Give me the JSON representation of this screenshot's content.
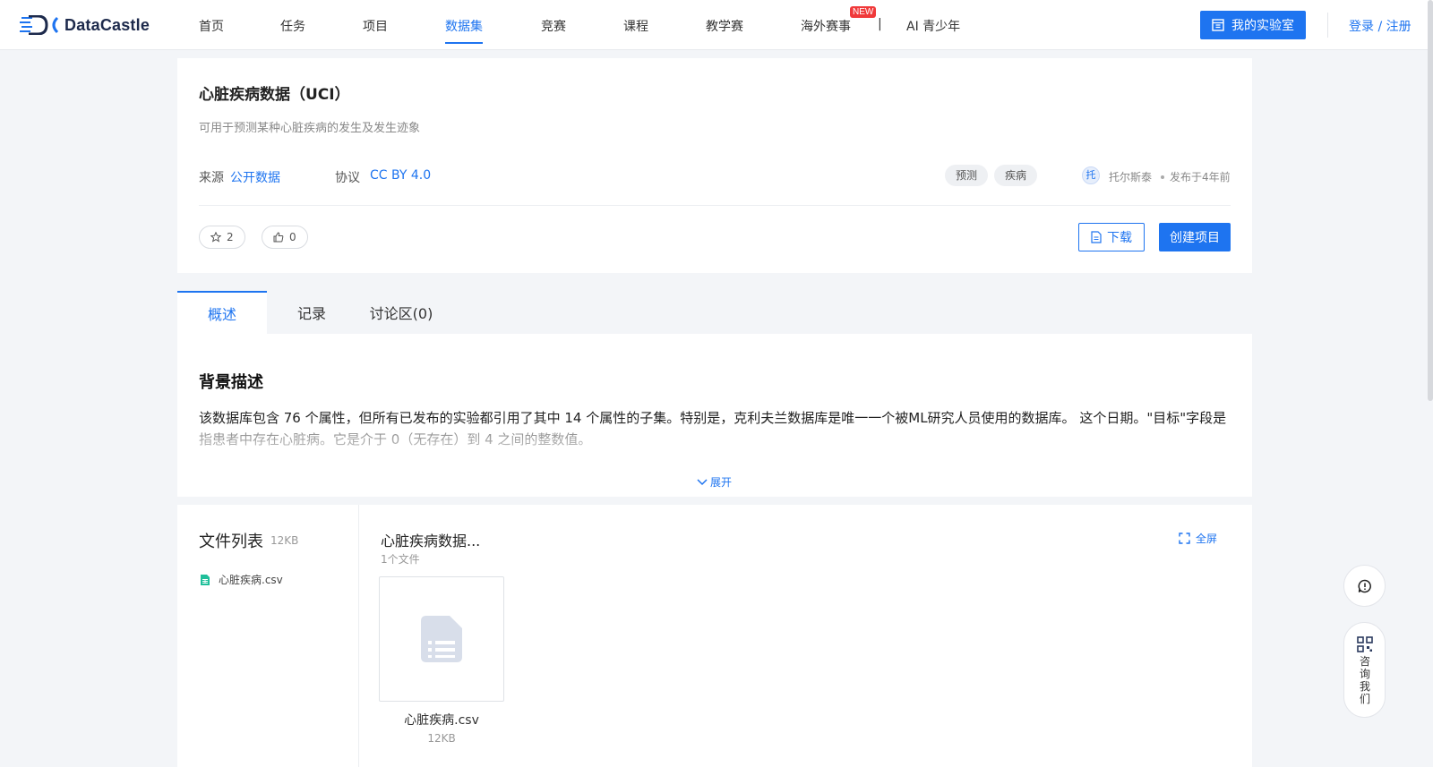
{
  "brand": {
    "name": "DataCastle",
    "accent": "#1e74f0"
  },
  "nav": {
    "items": [
      {
        "label": "首页"
      },
      {
        "label": "任务"
      },
      {
        "label": "项目"
      },
      {
        "label": "数据集"
      },
      {
        "label": "竞赛"
      },
      {
        "label": "课程"
      },
      {
        "label": "教学赛"
      },
      {
        "label": "海外赛事"
      },
      {
        "label": "AI 青少年"
      }
    ],
    "active_label": "数据集",
    "badge": "NEW",
    "separator": "|",
    "lab_button": "我的实验室",
    "login": "登录 / 注册"
  },
  "dataset": {
    "title": "心脏疾病数据（UCI）",
    "subtitle": "可用于预测某种心脏疾病的发生及发生迹象",
    "source_label": "来源",
    "source_value": "公开数据",
    "license_label": "协议",
    "license_value": "CC BY 4.0",
    "tags": [
      "预测",
      "疾病"
    ],
    "author_avatar": "托",
    "author": "托尔斯泰",
    "published": "发布于4年前",
    "stars": "2",
    "likes": "0",
    "download_label": "下载",
    "create_label": "创建项目"
  },
  "tabs": [
    {
      "label": "概述"
    },
    {
      "label": "记录"
    },
    {
      "label": "讨论区(0)"
    }
  ],
  "overview": {
    "heading": "背景描述",
    "text": "该数据库包含 76 个属性，但所有已发布的实验都引用了其中 14 个属性的子集。特别是，克利夫兰数据库是唯一一个被ML研究人员使用的数据库。 这个日期。\"目标\"字段是指患者中存在心脏病。它是介于 0（无存在）到 4 之间的整数值。",
    "expand": "展开"
  },
  "files": {
    "list_title": "文件列表",
    "list_size": "12KB",
    "items": [
      {
        "name": "心脏疾病.csv"
      }
    ],
    "folder_title": "心脏疾病数据...",
    "folder_count": "1个文件",
    "fullscreen": "全屏",
    "tile_name": "心脏疾病.csv",
    "tile_size": "12KB"
  },
  "float": {
    "consult": "咨询我们"
  },
  "icons": [
    "datacastle-logo-icon",
    "lab-icon",
    "star-icon",
    "thumb-up-icon",
    "file-icon",
    "chevron-down-icon",
    "csv-file-icon",
    "fullscreen-icon",
    "document-icon",
    "feedback-icon",
    "qr-code-icon"
  ]
}
